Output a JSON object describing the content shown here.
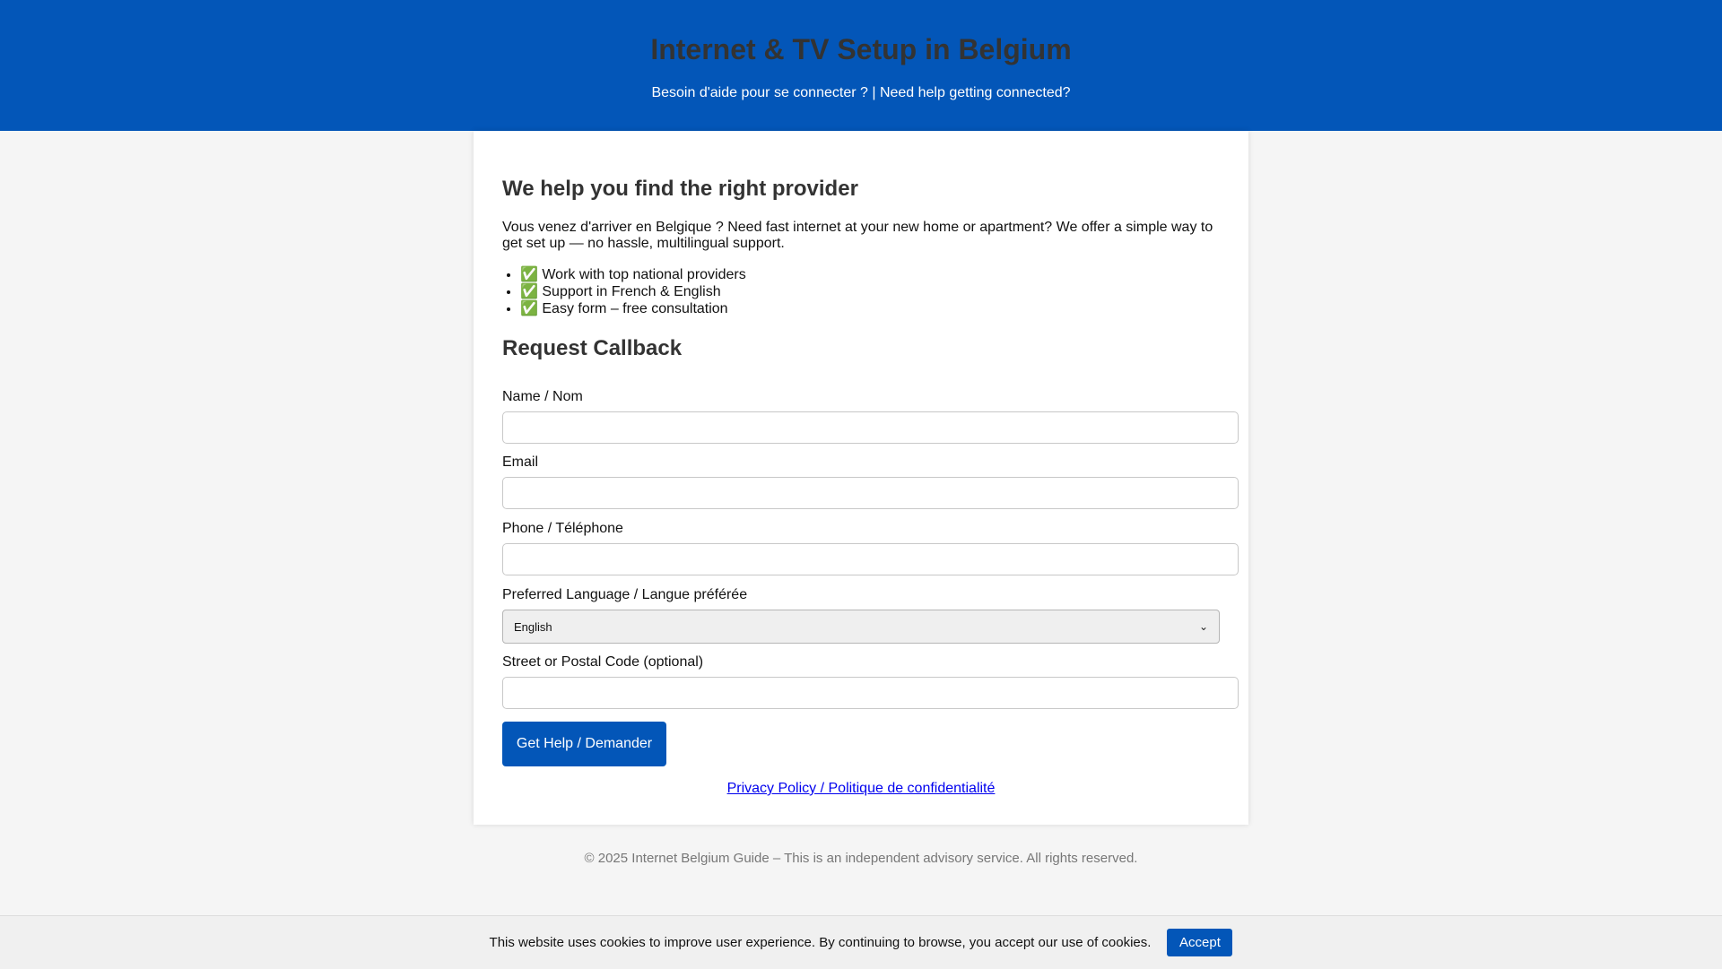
{
  "header": {
    "title": "Internet & TV Setup in Belgium",
    "subtitle": "Besoin d'aide pour se connecter ? | Need help getting connected?"
  },
  "intro": {
    "heading": "We help you find the right provider",
    "paragraph": "Vous venez d'arriver en Belgique ? Need fast internet at your new home or apartment? We offer a simple way to get set up — no hassle, multilingual support.",
    "benefits": [
      "✅ Work with top national providers",
      "✅ Support in French & English",
      "✅ Easy form – free consultation"
    ]
  },
  "form": {
    "heading": "Request Callback",
    "name_label": "Name / Nom",
    "name_value": "",
    "email_label": "Email",
    "email_value": "",
    "phone_label": "Phone / Téléphone",
    "phone_value": "",
    "language_label": "Preferred Language / Langue préférée",
    "language_selected": "English",
    "address_label": "Street or Postal Code (optional)",
    "address_value": "",
    "submit_label": "Get Help / Demander"
  },
  "privacy_link": "Privacy Policy / Politique de confidentialité",
  "footer_text": "© 2025 Internet Belgium Guide – This is an independent advisory service. All rights reserved.",
  "cookie": {
    "message": "This website uses cookies to improve user experience. By continuing to browse, you accept our use of cookies.",
    "accept_label": "Accept"
  },
  "colors": {
    "brand_blue": "#0356b8",
    "link": "#0000ee"
  }
}
